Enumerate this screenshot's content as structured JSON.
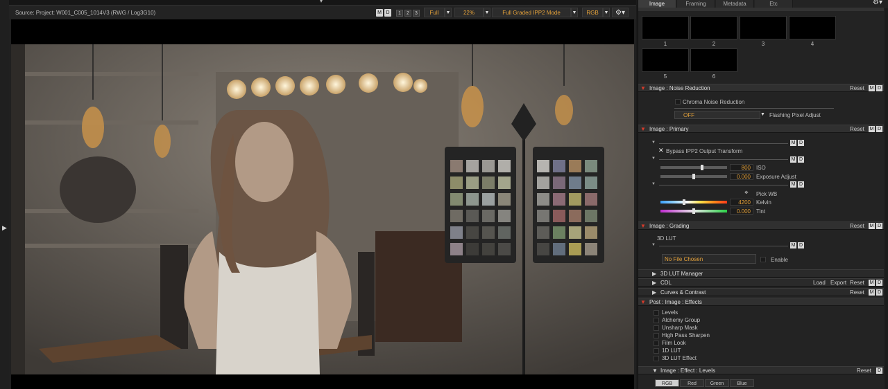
{
  "viewer": {
    "source": "Source: Project: W001_C005_1014V3    (RWG / Log3G10)",
    "m": "M",
    "d": "D",
    "n1": "1",
    "n2": "2",
    "n3": "3",
    "res": "Full",
    "zoom": "22%",
    "mode": "Full Graded IPP2 Mode",
    "channel": "RGB"
  },
  "tabs": [
    "Image",
    "Framing",
    "Metadata",
    "Etc"
  ],
  "thumbs": [
    "1",
    "2",
    "3",
    "4",
    "5",
    "6"
  ],
  "noise": {
    "title": "Image : Noise Reduction",
    "reset": "Reset",
    "chroma": "Chroma Noise Reduction",
    "off": "OFF",
    "flash": "Flashing Pixel Adjust"
  },
  "primary": {
    "title": "Image : Primary",
    "reset": "Reset",
    "bypass": "Bypass IPP2 Output Transform",
    "iso_val": "800",
    "iso": "ISO",
    "iso_level": 0.625,
    "exp_val": "0.000",
    "exp": "Exposure Adjust",
    "exp_level": 0.5,
    "pickwb": "Pick WB",
    "kelvin_val": "4200",
    "kelvin": "Kelvin",
    "kelvin_level": 0.35,
    "tint_val": "0.000",
    "tint": "Tint",
    "tint_level": 0.5
  },
  "grading": {
    "title": "Image : Grading",
    "reset": "Reset",
    "lut3d": "3D LUT",
    "nofile": "No File Chosen",
    "enable": "Enable"
  },
  "lutmgr": "3D LUT Manager",
  "cdl": {
    "title": "CDL",
    "load": "Load",
    "export": "Export",
    "reset": "Reset"
  },
  "curves": {
    "title": "Curves & Contrast",
    "reset": "Reset"
  },
  "effects": {
    "title": "Post : Image : Effects",
    "items": [
      "Levels",
      "Alchemy Group",
      "Unsharp Mask",
      "High Pass Sharpen",
      "Film Look",
      "1D LUT",
      "3D LUT Effect"
    ]
  },
  "levels": {
    "title": "Image : Effect : Levels",
    "reset": "Reset",
    "channels": [
      "RGB",
      "Red",
      "Green",
      "Blue"
    ]
  },
  "colors": {
    "accent": "#e5a23a",
    "section_arrow": "#d63b2b"
  }
}
